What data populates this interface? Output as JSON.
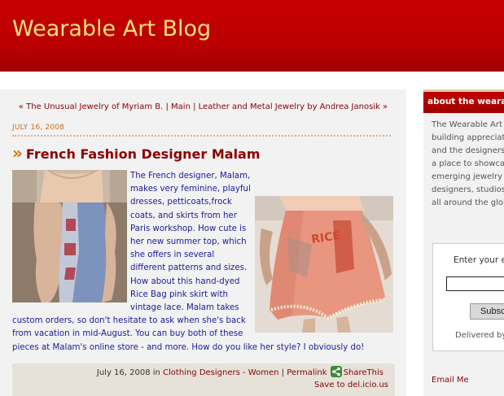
{
  "header": {
    "title": "Wearable Art Blog"
  },
  "nav": {
    "prev_prefix": "« ",
    "prev": "The Unusual Jewelry of Myriam B.",
    "sep1": " | ",
    "main": "Main",
    "sep2": " | ",
    "next": "Leather and Metal Jewelry by Andrea Janosik",
    "next_suffix": " »"
  },
  "post": {
    "date": "JULY 16, 2008",
    "title_marker": "»",
    "title": "French Fashion Designer Malam",
    "body": "The French designer, Malam, makes very feminine, playful dresses, petticoats,frock coats, and skirts from her Paris workshop. How cute is her new summer top, which she offers in several different patterns and sizes. How about this hand-dyed Rice Bag pink skirt with vintage lace. Malam takes custom orders, so don't hesitate to ask when she's back from vacation in mid-August. You can buy both of these pieces at Malam's online store - and more. How do you like her style? I obviously do!",
    "footer": {
      "posted": "July 16, 2008 in ",
      "category": "Clothing Designers - Women",
      "sep": " | ",
      "permalink": "Permalink",
      "share": "ShareThis",
      "delicious": "Save to del.icio.us"
    },
    "image2_text": "RICE"
  },
  "sidebar": {
    "heading": "about the wearable art blog",
    "about": "The Wearable Art Blog is dedicated to building appreciation for wearable art and the designers who create it. This is a place to showcase established and emerging jewelry and fashion designers, studios, and galleries from all around the globe.",
    "subscribe": {
      "label": "Enter your email address:",
      "button": "Subscribe",
      "delivered": "Delivered by FeedBurner"
    },
    "email_me": "Email Me"
  },
  "colors": {
    "header_red": "#c80000",
    "title_gold": "#f7e07c",
    "link_red": "#8a0000",
    "body_blue": "#1a1a9a",
    "date_orange": "#c97020"
  }
}
